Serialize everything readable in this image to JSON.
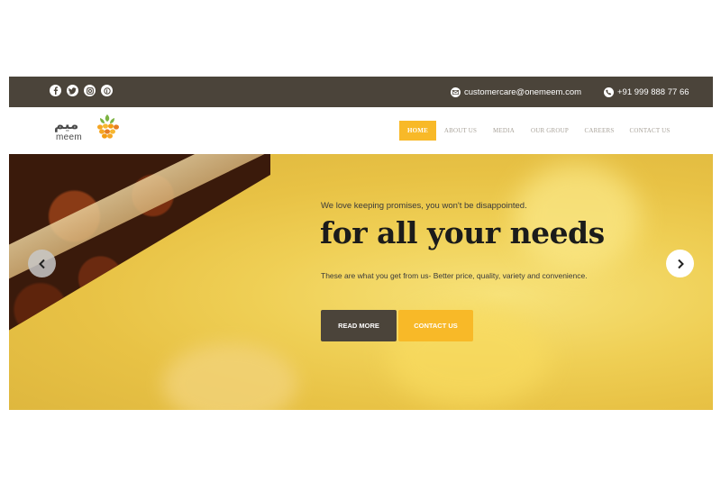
{
  "topbar": {
    "social_icons": [
      "facebook-icon",
      "twitter-icon",
      "instagram-icon",
      "pinterest-icon"
    ],
    "email": "customercare@onemeem.com",
    "phone": "+91 999 888 77 66"
  },
  "logo": {
    "arabic": "ميم",
    "english": "meem"
  },
  "nav": {
    "items": [
      {
        "label": "HOME",
        "active": true
      },
      {
        "label": "ABOUT US",
        "active": false
      },
      {
        "label": "MEDIA",
        "active": false
      },
      {
        "label": "OUR GROUP",
        "active": false
      },
      {
        "label": "CAREERS",
        "active": false
      },
      {
        "label": "CONTACT US",
        "active": false
      }
    ]
  },
  "hero": {
    "tagline": "We love keeping promises, you won't be disappointed.",
    "headline": "for all your needs",
    "subline": "These are what you get from us- Better price, quality, variety and convenience.",
    "primary_button": "READ MORE",
    "secondary_button": "CONTACT US"
  },
  "colors": {
    "topbar": "#4b443a",
    "accent": "#f8b928",
    "dark_button": "#4b443a"
  }
}
